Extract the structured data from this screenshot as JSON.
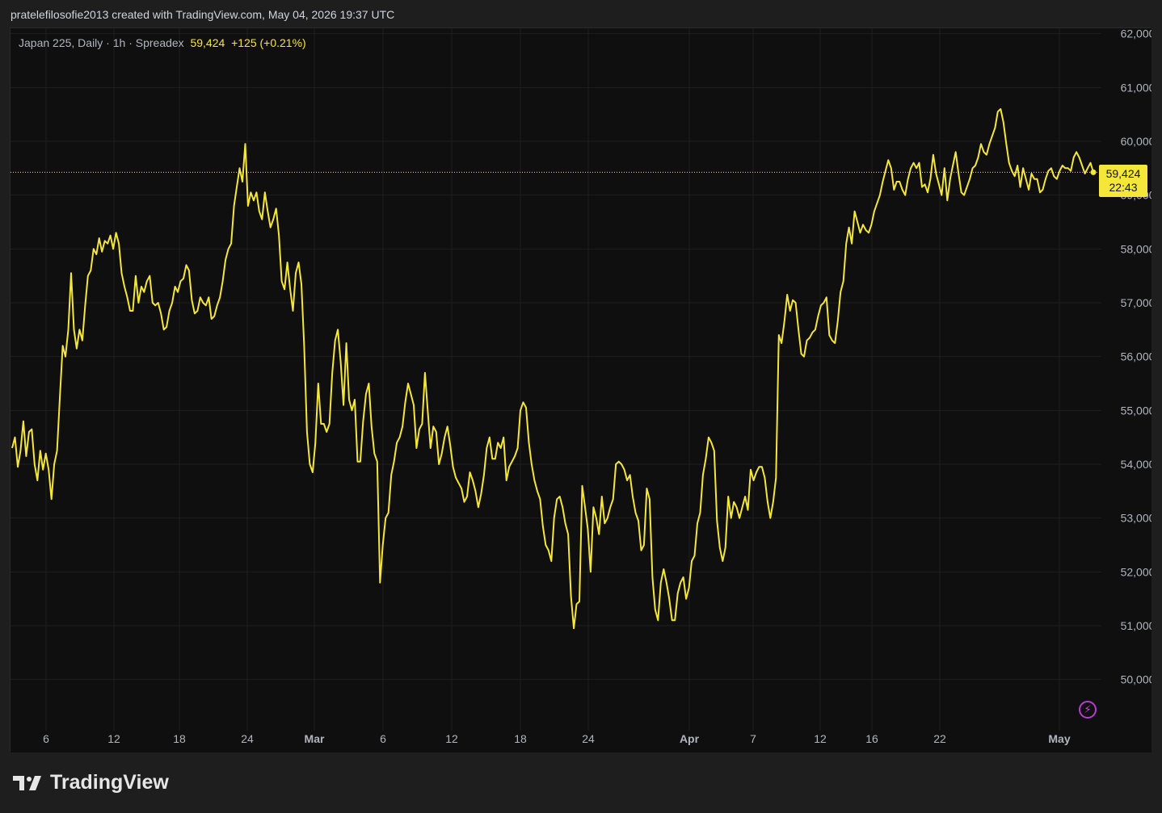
{
  "header": {
    "attribution": "pratelefilosofie2013 created with TradingView.com, May 04, 2026 19:37 UTC"
  },
  "legend": {
    "symbol": "Japan 225, Daily · 1h · Spreadex",
    "last": "59,424",
    "change": "+125 (+0.21%)"
  },
  "price_tag": {
    "price": "59,424",
    "countdown": "22:43"
  },
  "brand": {
    "name": "TradingView"
  },
  "colors": {
    "line": "#f5e63a",
    "background": "#0f0f0f",
    "grid": "#1f1f1f",
    "axis_text": "#b2b5be"
  },
  "chart_data": {
    "type": "line",
    "series": [
      {
        "values": [
          54300,
          54500,
          53950,
          54250,
          54800,
          54150,
          54600,
          54650,
          54000,
          53700,
          54250,
          53900,
          54200,
          53900,
          53350,
          54000,
          54250,
          55250,
          56200,
          56000,
          56500,
          57550,
          56500,
          56150,
          56500,
          56300,
          56950,
          57500,
          57600,
          58000,
          57900,
          58200,
          57950,
          58150,
          58100,
          58250,
          58000,
          58300,
          58100,
          57550,
          57300,
          57100,
          56850,
          56850,
          57500,
          57000,
          57300,
          57200,
          57400,
          57500,
          57000,
          56950,
          57000,
          56800,
          56500,
          56550,
          56850,
          57000,
          57300,
          57200,
          57400,
          57450,
          57700,
          57600,
          57050,
          56800,
          56850,
          57100,
          57000,
          56950,
          57100,
          56700,
          56750,
          56950,
          57100,
          57400,
          57800,
          58000,
          58100,
          58800,
          59150,
          59500,
          59250,
          59950,
          58800,
          59050,
          58900,
          59050,
          58700,
          58550,
          59050,
          58700,
          58400,
          58550,
          58750,
          58250,
          57400,
          57250,
          57750,
          57250,
          56850,
          57550,
          57750,
          57350,
          56200,
          54600,
          54000,
          53850,
          54400,
          55500,
          54750,
          54750,
          54600,
          54750,
          55700,
          56300,
          56500,
          55900,
          55100,
          56250,
          55200,
          55000,
          55200,
          54050,
          54050,
          54800,
          55300,
          55500,
          54700,
          54200,
          54050,
          51800,
          52500,
          53000,
          53100,
          53800,
          54050,
          54400,
          54500,
          54700,
          55150,
          55500,
          55300,
          55100,
          54300,
          54650,
          54750,
          55700,
          55000,
          54300,
          54700,
          54600,
          54000,
          54200,
          54500,
          54700,
          54350,
          53950,
          53750,
          53650,
          53550,
          53300,
          53400,
          53850,
          53700,
          53500,
          53200,
          53450,
          53800,
          54300,
          54500,
          54100,
          54100,
          54400,
          54300,
          54500,
          53700,
          53950,
          54050,
          54150,
          54300,
          55000,
          55150,
          55050,
          54400,
          54000,
          53700,
          53500,
          53350,
          52850,
          52500,
          52400,
          52200,
          53000,
          53350,
          53400,
          53200,
          52900,
          52700,
          51550,
          50950,
          51400,
          51450,
          53600,
          53200,
          52800,
          52000,
          53200,
          53000,
          52700,
          53400,
          52900,
          53000,
          53200,
          53350,
          54000,
          54050,
          54000,
          53900,
          53700,
          53800,
          53400,
          53100,
          52950,
          52400,
          52500,
          53550,
          53350,
          51900,
          51300,
          51100,
          51800,
          52050,
          51800,
          51500,
          51100,
          51100,
          51600,
          51800,
          51900,
          51500,
          51700,
          52200,
          52300,
          52900,
          53100,
          53800,
          54100,
          54500,
          54400,
          54250,
          52950,
          52450,
          52200,
          52450,
          53400,
          53000,
          53300,
          53200,
          53000,
          53200,
          53400,
          53150,
          53900,
          53700,
          53850,
          53950,
          53950,
          53750,
          53300,
          53000,
          53300,
          53750,
          56400,
          56250,
          56650,
          57150,
          56850,
          57050,
          57000,
          56500,
          56050,
          56000,
          56300,
          56350,
          56450,
          56500,
          56750,
          56950,
          57000,
          57100,
          56400,
          56300,
          56250,
          56650,
          57200,
          57400,
          58100,
          58400,
          58100,
          58700,
          58500,
          58300,
          58450,
          58350,
          58300,
          58450,
          58700,
          58850,
          59000,
          59250,
          59450,
          59650,
          59500,
          59100,
          59250,
          59250,
          59100,
          59000,
          59300,
          59500,
          59600,
          59500,
          59600,
          59150,
          59200,
          59050,
          59300,
          59750,
          59400,
          59200,
          59000,
          59500,
          58900,
          59300,
          59550,
          59800,
          59400,
          59050,
          59000,
          59150,
          59300,
          59500,
          59550,
          59700,
          59950,
          59800,
          59750,
          59950,
          60100,
          60250,
          60550,
          60600,
          60350,
          59950,
          59600,
          59450,
          59350,
          59550,
          59150,
          59500,
          59300,
          59100,
          59400,
          59300,
          59300,
          59050,
          59100,
          59300,
          59450,
          59500,
          59350,
          59300,
          59450,
          59550,
          59500,
          59500,
          59450,
          59700,
          59800,
          59700,
          59550,
          59400,
          59500,
          59600,
          59424
        ]
      }
    ],
    "x_ticks": [
      "6",
      "12",
      "18",
      "24",
      "Mar",
      "6",
      "12",
      "18",
      "24",
      "Apr",
      "7",
      "12",
      "16",
      "22",
      "May"
    ],
    "y_ticks": [
      "62,000",
      "61,000",
      "60,000",
      "59,000",
      "58,000",
      "57,000",
      "56,000",
      "55,000",
      "54,000",
      "53,000",
      "52,000",
      "51,000",
      "50,000"
    ],
    "ylim": [
      49500,
      62100
    ],
    "last_value": 59424,
    "grid": true
  }
}
